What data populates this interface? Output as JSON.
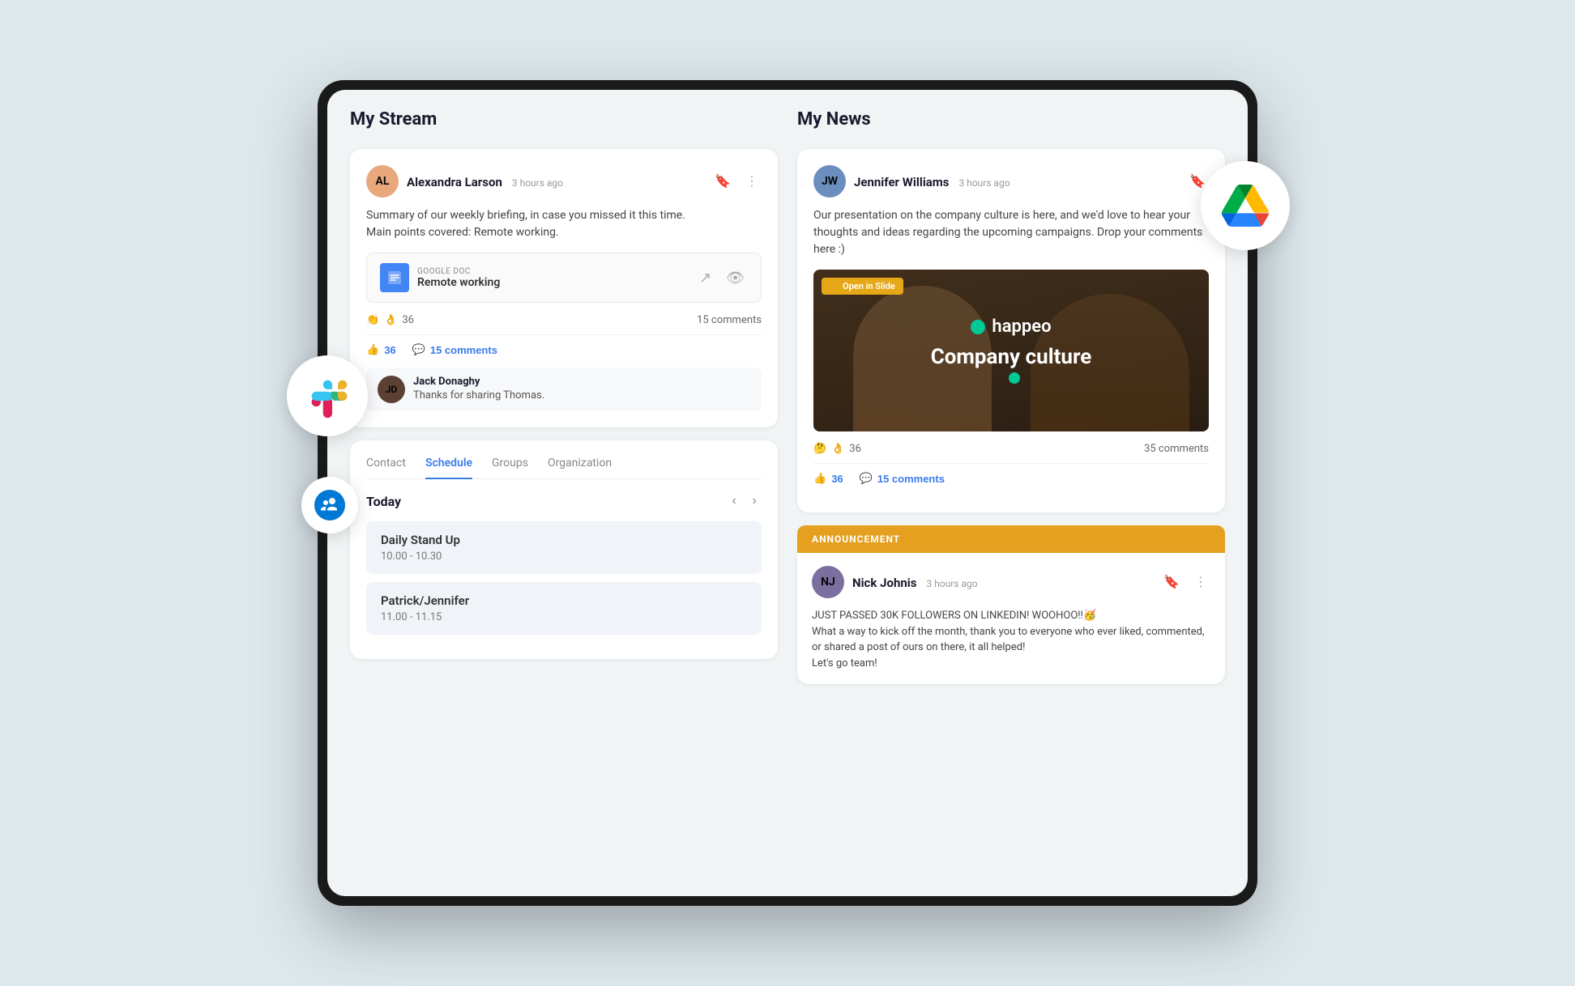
{
  "page": {
    "background": "#dde8ed"
  },
  "left_column": {
    "title": "My Stream",
    "stream_post": {
      "author": "Alexandra Larson",
      "time": "3 hours ago",
      "body_line1": "Summary of our weekly briefing, in case you missed it this time.",
      "body_line2": "Main points covered: Remote working.",
      "attachment": {
        "type_label": "GOOGLE DOC",
        "title": "Remote working"
      },
      "reactions": {
        "emoji1": "👏",
        "emoji2": "👌",
        "count": "36",
        "comments_label": "15 comments"
      },
      "like_count": "36",
      "comment_count": "15 comments",
      "comment": {
        "author": "Jack Donaghy",
        "text": "Thanks for sharing Thomas."
      }
    },
    "schedule_card": {
      "tabs": [
        "Contact",
        "Schedule",
        "Groups",
        "Organization"
      ],
      "active_tab": "Schedule",
      "today_label": "Today",
      "events": [
        {
          "title": "Daily Stand Up",
          "time": "10.00 - 10.30"
        },
        {
          "title": "Patrick/Jennifer",
          "time": "11.00 - 11.15"
        }
      ]
    }
  },
  "right_column": {
    "title": "My News",
    "news_post": {
      "author": "Jennifer Williams",
      "time": "3 hours ago",
      "body": "Our presentation on the company culture is here, and we'd love to hear your thoughts and ideas regarding the upcoming campaigns. Drop your comments here :)",
      "presentation": {
        "badge": "Open in Slide",
        "happeo_label": "happeo",
        "culture_label": "Company culture"
      },
      "reactions": {
        "emoji1": "🤔",
        "emoji2": "👌",
        "count": "36",
        "comments_label": "35 comments"
      },
      "like_count": "36",
      "comment_count": "15 comments"
    },
    "announcement": {
      "banner_label": "ANNOUNCEMENT",
      "author": "Nick Johnis",
      "time": "3 hours ago",
      "text_line1": "JUST PASSED 30K FOLLOWERS ON LINKEDIN! WOOHOO!!🥳",
      "text_line2": "What a way to kick off the month, thank you to everyone who ever liked, commented, or shared a post of ours on there, it all helped!",
      "text_line3": "Let's go team!"
    }
  },
  "icons": {
    "bookmark": "🔖",
    "more": "⋮",
    "share": "↗",
    "eye": "👁",
    "like": "👍",
    "comment": "💬",
    "chevron_left": "‹",
    "chevron_right": "›"
  }
}
